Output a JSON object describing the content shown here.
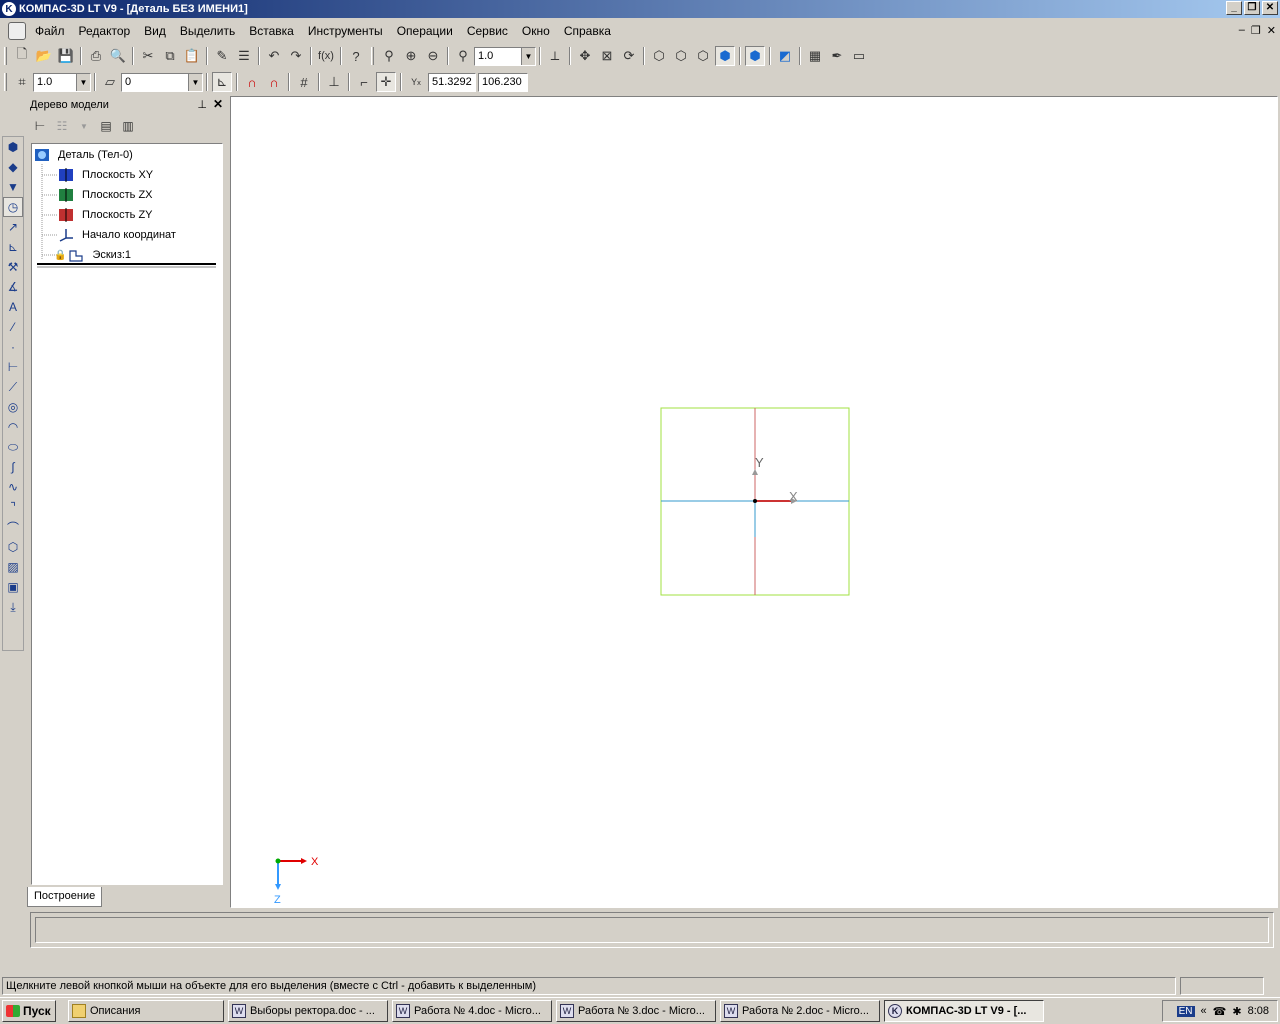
{
  "window": {
    "title": "КОМПАС-3D LT V9 - [Деталь БЕЗ ИМЕНИ1]",
    "app_icon": "kompas-icon"
  },
  "menu": [
    "Файл",
    "Редактор",
    "Вид",
    "Выделить",
    "Вставка",
    "Инструменты",
    "Операции",
    "Сервис",
    "Окно",
    "Справка"
  ],
  "toolbar": {
    "zoom_value": "1.0"
  },
  "toolbar2": {
    "step_value": "1.0",
    "layer_value": "0",
    "coord_x": "51.3292",
    "coord_y": "106.230"
  },
  "panel": {
    "title": "Дерево модели",
    "tree": [
      {
        "label": "Деталь (Тел-0)",
        "icon": "part-icon"
      },
      {
        "label": "Плоскость XY",
        "icon": "plane-xy-icon"
      },
      {
        "label": "Плоскость ZX",
        "icon": "plane-zx-icon"
      },
      {
        "label": "Плоскость ZY",
        "icon": "plane-zy-icon"
      },
      {
        "label": "Начало координат",
        "icon": "origin-icon"
      },
      {
        "label": "Эскиз:1",
        "icon": "sketch-icon"
      }
    ],
    "tab": "Построение"
  },
  "canvas": {
    "axis_labels": {
      "y": "Y",
      "x": "X"
    },
    "triad_labels": {
      "x": "X",
      "z": "Z"
    },
    "colors": {
      "frame": "#a0e040",
      "x_axis": "#3399cc",
      "y_axis": "#cc6666",
      "triad_x": "#e00000",
      "triad_z": "#3399ff"
    }
  },
  "status": {
    "message": "Щелкните левой кнопкой мыши на объекте для его выделения (вместе с Ctrl - добавить к выделенным)"
  },
  "taskbar": {
    "start": "Пуск",
    "items": [
      {
        "label": "Описания",
        "icon": "folder-icon"
      },
      {
        "label": "Выборы ректора.doc - ...",
        "icon": "word-icon"
      },
      {
        "label": "Работа № 4.doc - Micro...",
        "icon": "word-icon"
      },
      {
        "label": "Работа № 3.doc - Micro...",
        "icon": "word-icon"
      },
      {
        "label": "Работа № 2.doc - Micro...",
        "icon": "word-icon"
      },
      {
        "label": "КОМПАС-3D LT V9 - [...",
        "icon": "kompas-icon",
        "active": true
      }
    ],
    "lang": "EN",
    "clock": "8:08"
  }
}
